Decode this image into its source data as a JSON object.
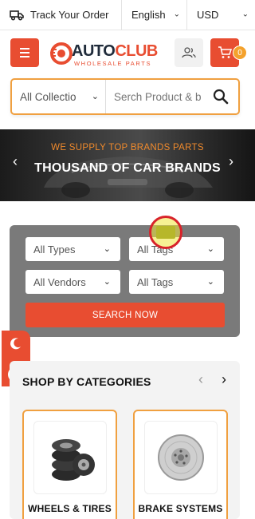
{
  "topbar": {
    "track_order": "Track Your Order",
    "language": "English",
    "currency": "USD"
  },
  "header": {
    "logo_part1": "AUTO",
    "logo_part2": "CLUB",
    "logo_tagline": "WHOLESALE PARTS",
    "cart_count": "0"
  },
  "search": {
    "collection": "All Collectio",
    "placeholder": "Serch Product & b"
  },
  "banner": {
    "subtitle": "WE SUPPLY TOP BRANDS PARTS",
    "title": "THOUSAND OF CAR BRANDS",
    "prev": "‹",
    "next": "›"
  },
  "filter": {
    "types": "All Types",
    "tags1": "All Tags",
    "vendors": "All Vendors",
    "tags2": "All Tags",
    "button": "SEARCH NOW"
  },
  "categories": {
    "title": "SHOP BY CATEGORIES",
    "prev": "‹",
    "next": "›",
    "items": [
      {
        "label": "WHEELS & TIRES"
      },
      {
        "label": "BRAKE SYSTEMS"
      }
    ]
  },
  "colors": {
    "accent": "#e84d31",
    "border_orange": "#f0a040",
    "badge": "#f4a22d"
  }
}
